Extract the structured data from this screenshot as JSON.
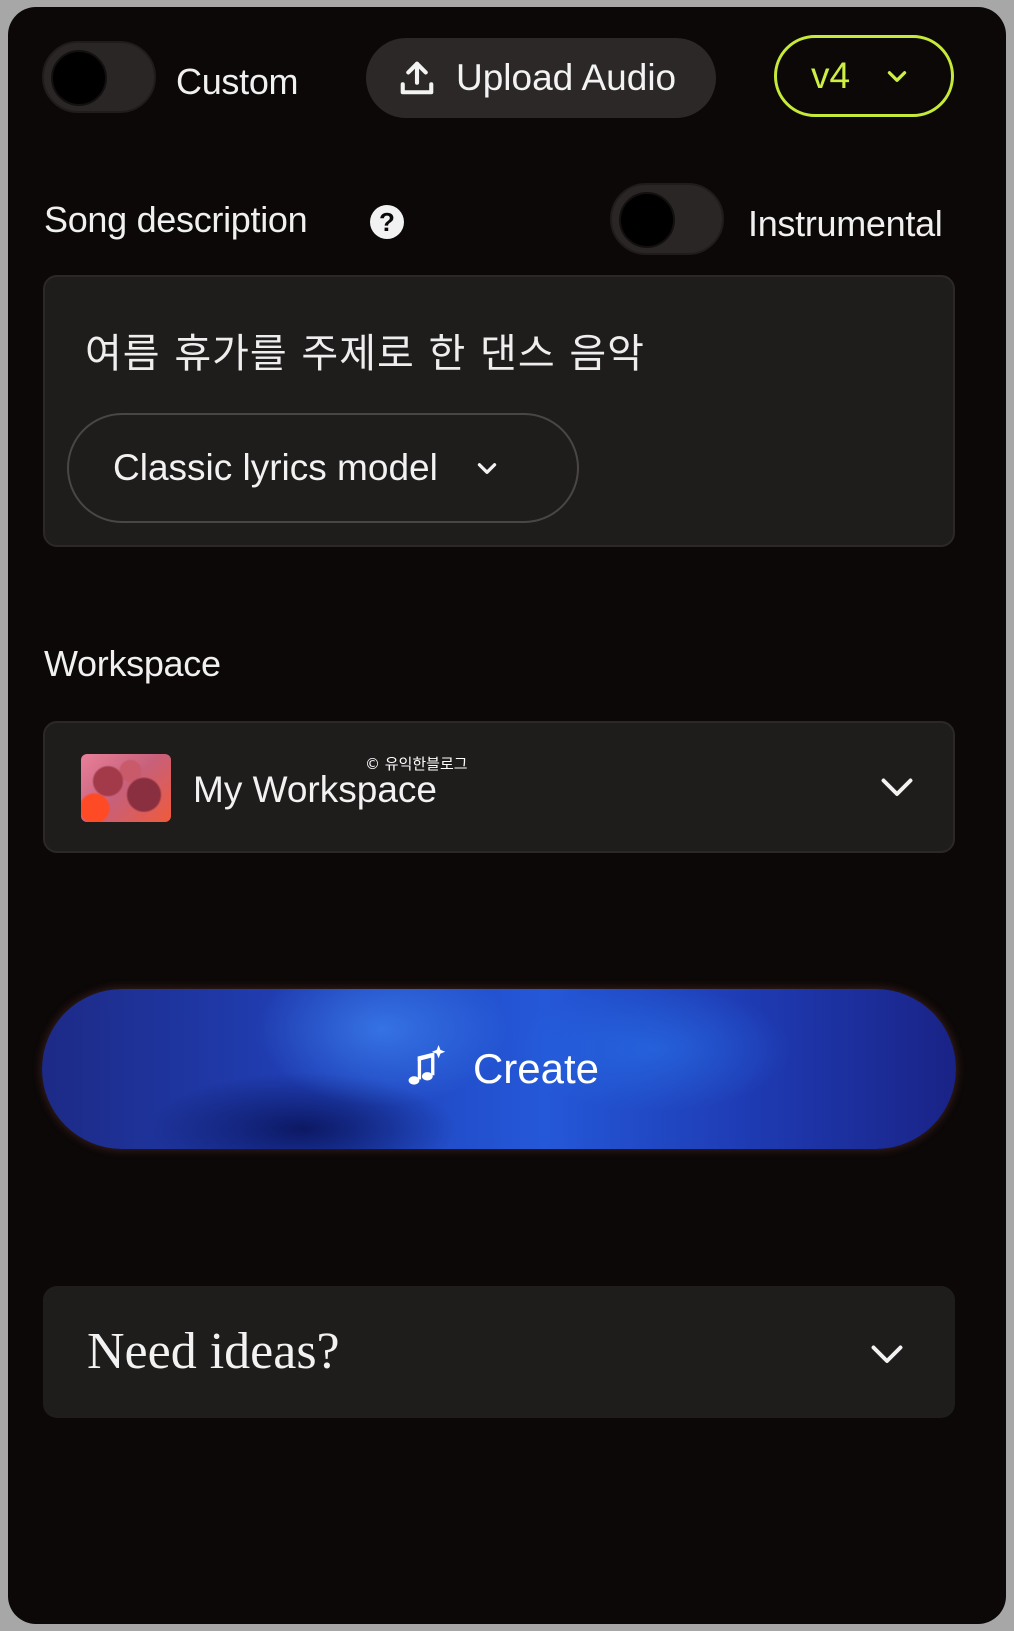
{
  "top_bar": {
    "custom_label": "Custom",
    "custom_enabled": false,
    "upload_label": "Upload Audio",
    "version_label": "v4",
    "accent_color": "#cdee43"
  },
  "song": {
    "description_label": "Song description",
    "help_icon": "?",
    "instrumental_label": "Instrumental",
    "instrumental_enabled": false,
    "description_text": "여름 휴가를 주제로 한 댄스 음악",
    "lyrics_model_label": "Classic lyrics model"
  },
  "workspace": {
    "label": "Workspace",
    "selected_name": "My Workspace",
    "watermark": "© 유익한블로그"
  },
  "create": {
    "label": "Create",
    "icon": "music-sparkle-icon"
  },
  "ideas": {
    "label": "Need ideas?"
  }
}
